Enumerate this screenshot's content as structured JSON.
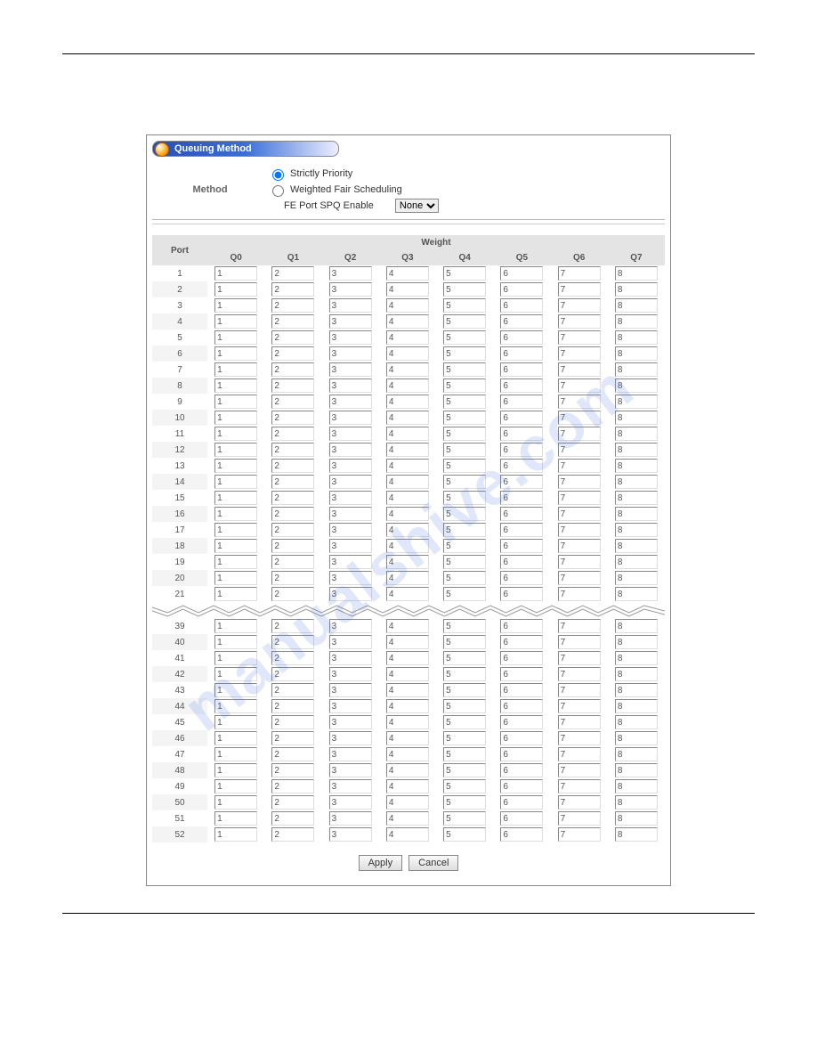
{
  "watermark": "manualshive.com",
  "section_title": "Queuing Method",
  "method": {
    "label": "Method",
    "option1": "Strictly Priority",
    "option2": "Weighted Fair Scheduling",
    "fe_label": "FE Port SPQ Enable",
    "fe_select_value": "None"
  },
  "table": {
    "port_header": "Port",
    "weight_header": "Weight",
    "columns": [
      "Q0",
      "Q1",
      "Q2",
      "Q3",
      "Q4",
      "Q5",
      "Q6",
      "Q7"
    ],
    "default_values": [
      "1",
      "2",
      "3",
      "4",
      "5",
      "6",
      "7",
      "8"
    ],
    "ports_top": [
      "1",
      "2",
      "3",
      "4",
      "5",
      "6",
      "7",
      "8",
      "9",
      "10",
      "11",
      "12",
      "13",
      "14",
      "15",
      "16",
      "17",
      "18",
      "19",
      "20",
      "21"
    ],
    "ports_bottom": [
      "39",
      "40",
      "41",
      "42",
      "43",
      "44",
      "45",
      "46",
      "47",
      "48",
      "49",
      "50",
      "51",
      "52"
    ]
  },
  "buttons": {
    "apply": "Apply",
    "cancel": "Cancel"
  }
}
